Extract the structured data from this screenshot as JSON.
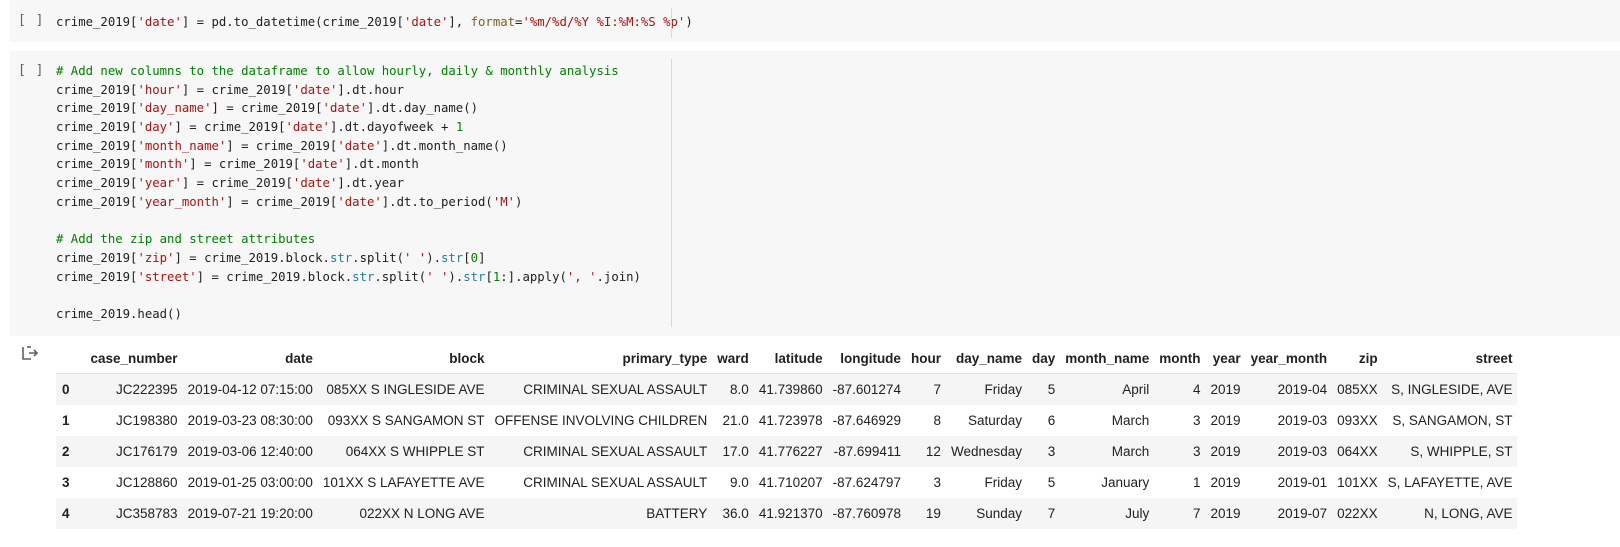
{
  "cells": [
    {
      "prompt": "[ ]",
      "lines": [
        [
          {
            "t": "crime_2019[",
            "c": ""
          },
          {
            "t": "'date'",
            "c": "str"
          },
          {
            "t": "] = pd.to_datetime(crime_2019[",
            "c": ""
          },
          {
            "t": "'date'",
            "c": "str"
          },
          {
            "t": "], ",
            "c": ""
          },
          {
            "t": "format",
            "c": "kw"
          },
          {
            "t": "=",
            "c": ""
          },
          {
            "t": "'%m/%d/%Y %I:%M:%S %p'",
            "c": "str"
          },
          {
            "t": ")",
            "c": ""
          }
        ]
      ]
    },
    {
      "prompt": "[ ]",
      "lines": [
        [
          {
            "t": "# Add new columns to the dataframe to allow hourly, daily & monthly analysis",
            "c": "cm"
          }
        ],
        [
          {
            "t": "crime_2019[",
            "c": ""
          },
          {
            "t": "'hour'",
            "c": "str"
          },
          {
            "t": "] = crime_2019[",
            "c": ""
          },
          {
            "t": "'date'",
            "c": "str"
          },
          {
            "t": "].dt.hour",
            "c": ""
          }
        ],
        [
          {
            "t": "crime_2019[",
            "c": ""
          },
          {
            "t": "'day_name'",
            "c": "str"
          },
          {
            "t": "] = crime_2019[",
            "c": ""
          },
          {
            "t": "'date'",
            "c": "str"
          },
          {
            "t": "].dt.day_name()",
            "c": ""
          }
        ],
        [
          {
            "t": "crime_2019[",
            "c": ""
          },
          {
            "t": "'day'",
            "c": "str"
          },
          {
            "t": "] = crime_2019[",
            "c": ""
          },
          {
            "t": "'date'",
            "c": "str"
          },
          {
            "t": "].dt.dayofweek + ",
            "c": ""
          },
          {
            "t": "1",
            "c": "cm"
          }
        ],
        [
          {
            "t": "crime_2019[",
            "c": ""
          },
          {
            "t": "'month_name'",
            "c": "str"
          },
          {
            "t": "] = crime_2019[",
            "c": ""
          },
          {
            "t": "'date'",
            "c": "str"
          },
          {
            "t": "].dt.month_name()",
            "c": ""
          }
        ],
        [
          {
            "t": "crime_2019[",
            "c": ""
          },
          {
            "t": "'month'",
            "c": "str"
          },
          {
            "t": "] = crime_2019[",
            "c": ""
          },
          {
            "t": "'date'",
            "c": "str"
          },
          {
            "t": "].dt.month",
            "c": ""
          }
        ],
        [
          {
            "t": "crime_2019[",
            "c": ""
          },
          {
            "t": "'year'",
            "c": "str"
          },
          {
            "t": "] = crime_2019[",
            "c": ""
          },
          {
            "t": "'date'",
            "c": "str"
          },
          {
            "t": "].dt.year",
            "c": ""
          }
        ],
        [
          {
            "t": "crime_2019[",
            "c": ""
          },
          {
            "t": "'year_month'",
            "c": "str"
          },
          {
            "t": "] = crime_2019[",
            "c": ""
          },
          {
            "t": "'date'",
            "c": "str"
          },
          {
            "t": "].dt.to_period(",
            "c": ""
          },
          {
            "t": "'M'",
            "c": "str"
          },
          {
            "t": ")",
            "c": ""
          }
        ],
        [],
        [
          {
            "t": "# Add the zip and street attributes",
            "c": "cm"
          }
        ],
        [
          {
            "t": "crime_2019[",
            "c": ""
          },
          {
            "t": "'zip'",
            "c": "str"
          },
          {
            "t": "] = crime_2019.block.",
            "c": ""
          },
          {
            "t": "str",
            "c": "bi"
          },
          {
            "t": ".split(",
            "c": ""
          },
          {
            "t": "' '",
            "c": "str"
          },
          {
            "t": ").",
            "c": ""
          },
          {
            "t": "str",
            "c": "bi"
          },
          {
            "t": "[",
            "c": ""
          },
          {
            "t": "0",
            "c": "cm"
          },
          {
            "t": "]",
            "c": ""
          }
        ],
        [
          {
            "t": "crime_2019[",
            "c": ""
          },
          {
            "t": "'street'",
            "c": "str"
          },
          {
            "t": "] = crime_2019.block.",
            "c": ""
          },
          {
            "t": "str",
            "c": "bi"
          },
          {
            "t": ".split(",
            "c": ""
          },
          {
            "t": "' '",
            "c": "str"
          },
          {
            "t": ").",
            "c": ""
          },
          {
            "t": "str",
            "c": "bi"
          },
          {
            "t": "[",
            "c": ""
          },
          {
            "t": "1",
            "c": "cm"
          },
          {
            "t": ":].apply(",
            "c": ""
          },
          {
            "t": "', '",
            "c": "str"
          },
          {
            "t": ".join)",
            "c": ""
          }
        ],
        [],
        [
          {
            "t": "crime_2019.head()",
            "c": ""
          }
        ]
      ]
    }
  ],
  "output": {
    "icon": "output-arrow-icon",
    "table": {
      "columns": [
        "",
        "case_number",
        "date",
        "block",
        "primary_type",
        "ward",
        "latitude",
        "longitude",
        "hour",
        "day_name",
        "day",
        "month_name",
        "month",
        "year",
        "year_month",
        "zip",
        "street"
      ],
      "rows": [
        [
          "0",
          "JC222395",
          "2019-04-12 07:15:00",
          "085XX S INGLESIDE AVE",
          "CRIMINAL SEXUAL ASSAULT",
          "8.0",
          "41.739860",
          "-87.601274",
          "7",
          "Friday",
          "5",
          "April",
          "4",
          "2019",
          "2019-04",
          "085XX",
          "S, INGLESIDE, AVE"
        ],
        [
          "1",
          "JC198380",
          "2019-03-23 08:30:00",
          "093XX S SANGAMON ST",
          "OFFENSE INVOLVING CHILDREN",
          "21.0",
          "41.723978",
          "-87.646929",
          "8",
          "Saturday",
          "6",
          "March",
          "3",
          "2019",
          "2019-03",
          "093XX",
          "S, SANGAMON, ST"
        ],
        [
          "2",
          "JC176179",
          "2019-03-06 12:40:00",
          "064XX S WHIPPLE ST",
          "CRIMINAL SEXUAL ASSAULT",
          "17.0",
          "41.776227",
          "-87.699411",
          "12",
          "Wednesday",
          "3",
          "March",
          "3",
          "2019",
          "2019-03",
          "064XX",
          "S, WHIPPLE, ST"
        ],
        [
          "3",
          "JC128860",
          "2019-01-25 03:00:00",
          "101XX S LAFAYETTE AVE",
          "CRIMINAL SEXUAL ASSAULT",
          "9.0",
          "41.710207",
          "-87.624797",
          "3",
          "Friday",
          "5",
          "January",
          "1",
          "2019",
          "2019-01",
          "101XX",
          "S, LAFAYETTE, AVE"
        ],
        [
          "4",
          "JC358783",
          "2019-07-21 19:20:00",
          "022XX N LONG AVE",
          "BATTERY",
          "36.0",
          "41.921370",
          "-87.760978",
          "19",
          "Sunday",
          "7",
          "July",
          "7",
          "2019",
          "2019-07",
          "022XX",
          "N, LONG, AVE"
        ]
      ]
    }
  }
}
